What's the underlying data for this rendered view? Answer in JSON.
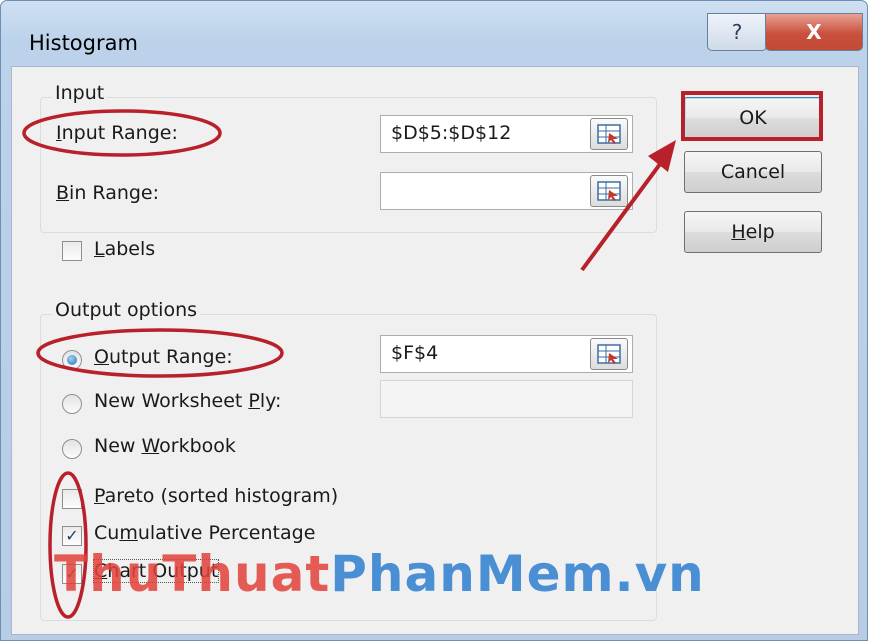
{
  "window": {
    "title": "Histogram",
    "help_glyph": "?",
    "close_glyph": "X"
  },
  "input_group": {
    "label": "Input",
    "input_range": {
      "label_prefix": "",
      "accel": "I",
      "label_rest": "nput Range:",
      "value": "$D$5:$D$12"
    },
    "bin_range": {
      "accel": "B",
      "label_rest": "in Range:",
      "value": ""
    },
    "labels": {
      "accel": "L",
      "label_rest": "abels",
      "checked": false
    }
  },
  "output_group": {
    "label": "Output options",
    "output_range": {
      "accel": "O",
      "label_rest": "utput Range:",
      "value": "$F$4",
      "selected": true
    },
    "new_ply": {
      "label_pre": "New Worksheet ",
      "accel": "P",
      "label_rest": "ly:",
      "value": ""
    },
    "new_workbook": {
      "label_pre": "New ",
      "accel": "W",
      "label_rest": "orkbook"
    },
    "pareto": {
      "label_pre": "",
      "accel": "P",
      "label_rest": "areto (sorted histogram)",
      "checked": false
    },
    "cumulative": {
      "label_pre": "Cu",
      "accel": "m",
      "label_rest": "ulative Percentage",
      "checked": true
    },
    "chart": {
      "label_pre": "",
      "accel": "C",
      "label_rest": "hart Output",
      "checked": true
    }
  },
  "buttons": {
    "ok": "OK",
    "cancel": "Cancel",
    "help_accel": "H",
    "help_rest": "elp"
  },
  "watermark": {
    "part1": "ThuThuat",
    "part2": "PhanMem.vn"
  },
  "colors": {
    "annotation_red": "#b8202a",
    "title_bg": "#bcd2ea",
    "client_bg": "#f0f0f0"
  }
}
